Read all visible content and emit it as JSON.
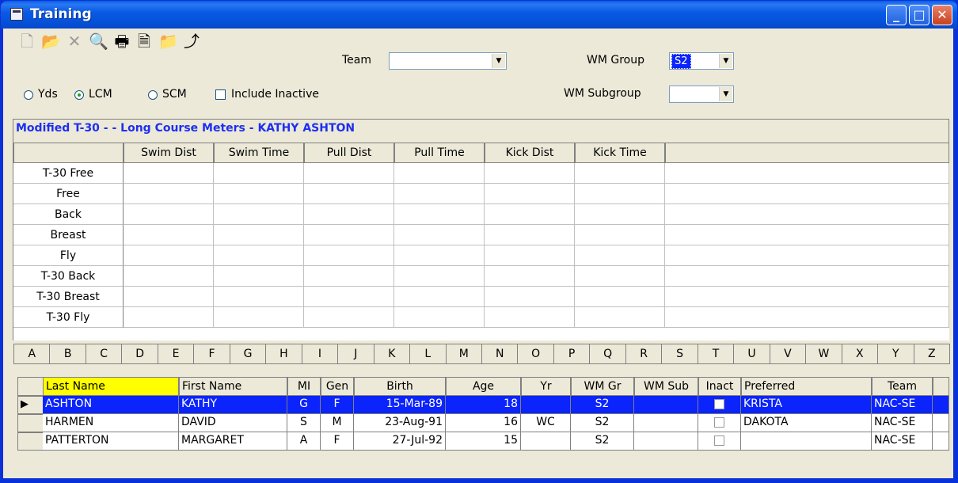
{
  "window": {
    "title": "Training"
  },
  "title_buttons": {
    "minimize": "_",
    "maximize": "□",
    "close": "✕"
  },
  "toolbar": {
    "icons": [
      "new-icon",
      "open-icon",
      "delete-icon",
      "find-icon",
      "print-icon",
      "print-preview-icon",
      "folder-open-icon",
      "import-icon"
    ],
    "team_label": "Team",
    "team_value": "",
    "wm_group_label": "WM Group",
    "wm_group_value": "S2",
    "wm_subgroup_label": "WM Subgroup",
    "wm_subgroup_value": ""
  },
  "course": {
    "yds_label": "Yds",
    "lcm_label": "LCM",
    "scm_label": "SCM",
    "selected": "LCM",
    "include_inactive_label": "Include Inactive",
    "include_inactive_checked": false
  },
  "panel": {
    "title": "Modified T-30 -  - Long Course Meters - KATHY ASHTON",
    "columns": [
      "Swim Dist",
      "Swim Time",
      "Pull Dist",
      "Pull Time",
      "Kick Dist",
      "Kick Time"
    ],
    "rows": [
      "T-30 Free",
      "Free",
      "Back",
      "Breast",
      "Fly",
      "T-30 Back",
      "T-30 Breast",
      "T-30 Fly"
    ]
  },
  "alphabet": [
    "A",
    "B",
    "C",
    "D",
    "E",
    "F",
    "G",
    "H",
    "I",
    "J",
    "K",
    "L",
    "M",
    "N",
    "O",
    "P",
    "Q",
    "R",
    "S",
    "T",
    "U",
    "V",
    "W",
    "X",
    "Y",
    "Z"
  ],
  "swimmers": {
    "columns": [
      "Last Name",
      "First Name",
      "MI",
      "Gen",
      "Birth",
      "Age",
      "Yr",
      "WM Gr",
      "WM Sub",
      "Inact",
      "Preferred",
      "Team"
    ],
    "rows": [
      {
        "last": "ASHTON",
        "first": "KATHY",
        "mi": "G",
        "gen": "F",
        "birth": "15-Mar-89",
        "age": "18",
        "yr": "",
        "wmgr": "S2",
        "wmsub": "",
        "inact": false,
        "preferred": "KRISTA",
        "team": "NAC-SE",
        "selected": true
      },
      {
        "last": "HARMEN",
        "first": "DAVID",
        "mi": "S",
        "gen": "M",
        "birth": "23-Aug-91",
        "age": "16",
        "yr": "WC",
        "wmgr": "S2",
        "wmsub": "",
        "inact": false,
        "preferred": "DAKOTA",
        "team": "NAC-SE",
        "selected": false
      },
      {
        "last": "PATTERTON",
        "first": "MARGARET",
        "mi": "A",
        "gen": "F",
        "birth": "27-Jul-92",
        "age": "15",
        "yr": "",
        "wmgr": "S2",
        "wmsub": "",
        "inact": false,
        "preferred": "",
        "team": "NAC-SE",
        "selected": false
      }
    ]
  },
  "colors": {
    "titlebar": "#0a5ae6",
    "selection": "#0b24fb",
    "panel_title": "#1d2ff0",
    "sorted_header": "#ffff00"
  }
}
